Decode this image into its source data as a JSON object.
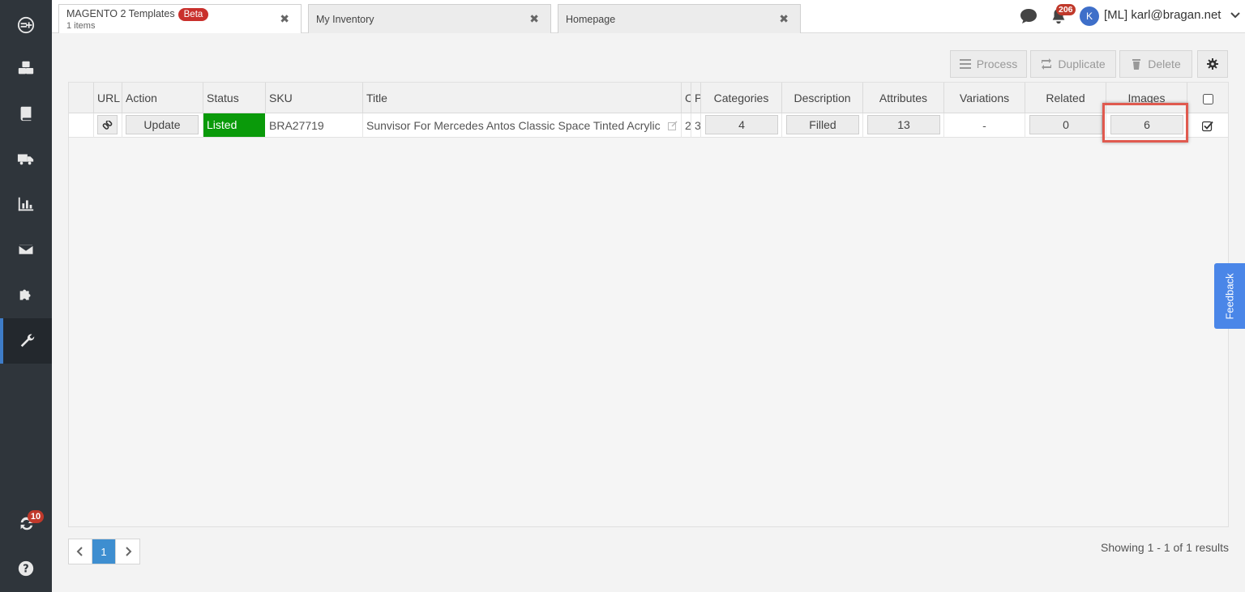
{
  "tabs": [
    {
      "title": "MAGENTO 2 Templates",
      "badge": "Beta",
      "subtitle": "1 items"
    },
    {
      "title": "My Inventory"
    },
    {
      "title": "Homepage"
    }
  ],
  "topbar": {
    "notifications": "206",
    "avatar_letter": "K",
    "user": "[ML] karl@bragan.net"
  },
  "sidebar": {
    "sync_badge": "10"
  },
  "toolbar": {
    "process": "Process",
    "duplicate": "Duplicate",
    "delete": "Delete"
  },
  "table": {
    "headers": {
      "url": "URL",
      "action": "Action",
      "status": "Status",
      "sku": "SKU",
      "title": "Title",
      "c": "C",
      "p": "P",
      "categories": "Categories",
      "description": "Description",
      "attributes": "Attributes",
      "variations": "Variations",
      "related": "Related",
      "images": "Images"
    },
    "row": {
      "action": "Update",
      "status": "Listed",
      "sku": "BRA27719",
      "title": "Sunvisor For Mercedes Antos Classic Space Tinted Acrylic",
      "c": "2",
      "p": "3",
      "categories": "4",
      "description": "Filled",
      "attributes": "13",
      "variations": "-",
      "related": "0",
      "images": "6"
    }
  },
  "feedback": "Feedback",
  "pagination": {
    "current": "1",
    "results": "Showing 1 - 1 of 1 results"
  },
  "colors": {
    "sidebar": "#2f353b",
    "listed": "#0a9a0a",
    "accent": "#3e8ed0",
    "highlight": "#e05a4f"
  }
}
